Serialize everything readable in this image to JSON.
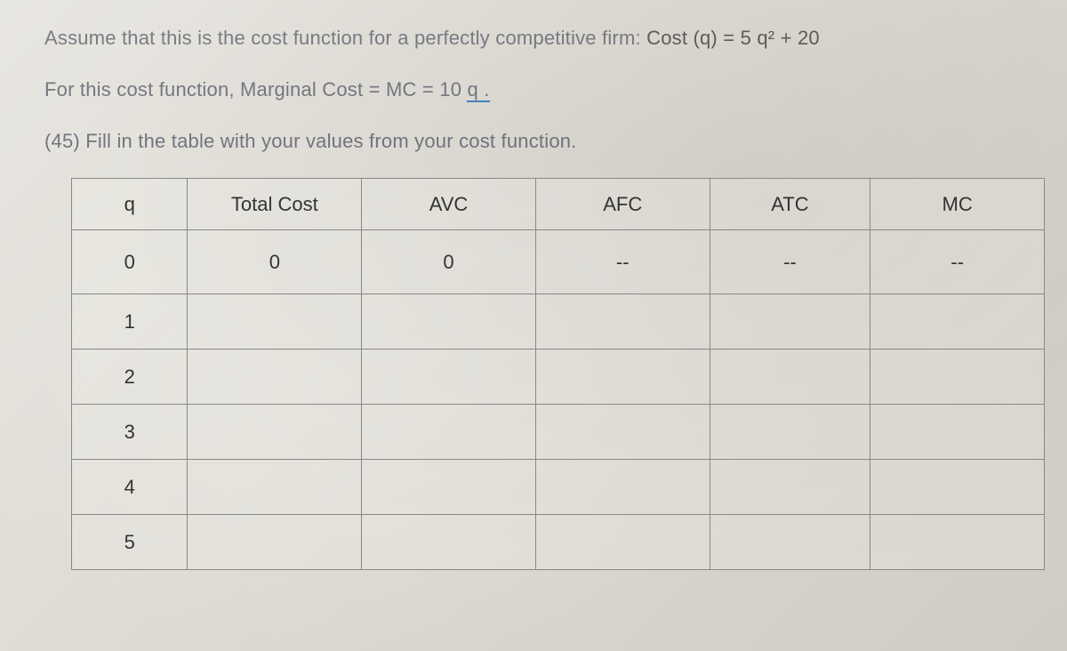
{
  "instructions": {
    "line1_prefix": "Assume that this is the cost function for a perfectly competitive firm:  ",
    "line1_formula": "Cost (q) = 5 q² + 20",
    "line2_prefix": "For this cost function, Marginal Cost = MC = 10 ",
    "line2_underlined": "q .",
    "line3": "(45) Fill in the table with your values from your cost function."
  },
  "table": {
    "headers": {
      "q": "q",
      "total_cost": "Total Cost",
      "avc": "AVC",
      "afc": "AFC",
      "atc": "ATC",
      "mc": "MC"
    },
    "rows": [
      {
        "q": "0",
        "total_cost": "0",
        "avc": "0",
        "afc": "--",
        "atc": "--",
        "mc": "--"
      },
      {
        "q": "1",
        "total_cost": "",
        "avc": "",
        "afc": "",
        "atc": "",
        "mc": ""
      },
      {
        "q": "2",
        "total_cost": "",
        "avc": "",
        "afc": "",
        "atc": "",
        "mc": ""
      },
      {
        "q": "3",
        "total_cost": "",
        "avc": "",
        "afc": "",
        "atc": "",
        "mc": ""
      },
      {
        "q": "4",
        "total_cost": "",
        "avc": "",
        "afc": "",
        "atc": "",
        "mc": ""
      },
      {
        "q": "5",
        "total_cost": "",
        "avc": "",
        "afc": "",
        "atc": "",
        "mc": ""
      }
    ]
  }
}
